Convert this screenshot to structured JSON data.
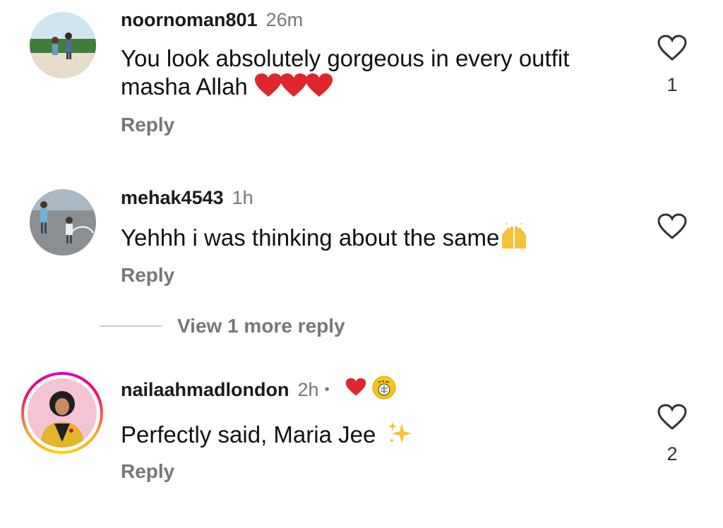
{
  "comments": [
    {
      "username": "noornoman801",
      "time": "26m",
      "text_line1": "You look absolutely gorgeous in every outfit",
      "text_line2": "masha Allah",
      "emoji_names": [
        "red-heart-icon",
        "red-heart-icon",
        "red-heart-icon"
      ],
      "reply_label": "Reply",
      "like_count": "1"
    },
    {
      "username": "mehak4543",
      "time": "1h",
      "text": "Yehhh i was thinking about the same",
      "emoji_names": [
        "raising-hands-icon"
      ],
      "reply_label": "Reply",
      "like_count": ""
    },
    {
      "username": "nailaahmadlondon",
      "time": "2h",
      "separator": "•",
      "badges": [
        "red-heart-icon",
        "creator-badge-icon"
      ],
      "text": "Perfectly said, Maria Jee",
      "emoji_names": [
        "sparkles-icon"
      ],
      "reply_label": "Reply",
      "like_count": "2"
    }
  ],
  "view_more": {
    "label": "View 1 more reply"
  },
  "colors": {
    "text": "#111111",
    "secondary": "#777777",
    "heart": "#e0262c",
    "story_ring_start": "#f9a33c",
    "story_ring_end": "#d300c5"
  }
}
